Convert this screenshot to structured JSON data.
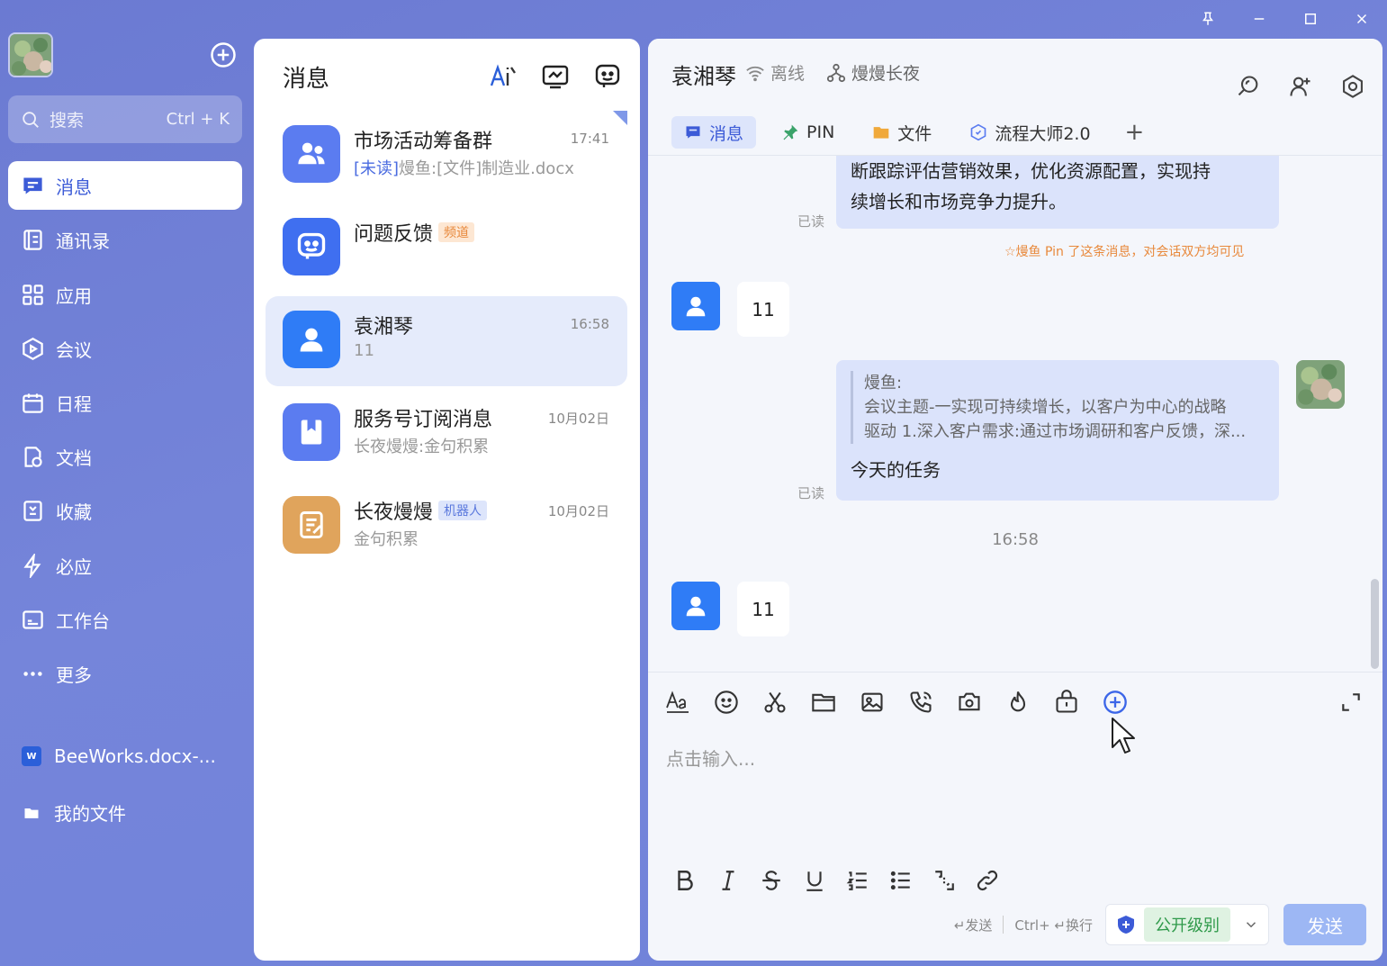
{
  "window": {
    "controls": [
      "pin-icon",
      "minimize-icon",
      "maximize-icon",
      "close-icon"
    ]
  },
  "nav": {
    "search": {
      "placeholder": "搜索",
      "shortcut": "Ctrl + K"
    },
    "items": [
      {
        "label": "消息",
        "icon": "message-icon",
        "active": true
      },
      {
        "label": "通讯录",
        "icon": "contacts-icon"
      },
      {
        "label": "应用",
        "icon": "apps-icon"
      },
      {
        "label": "会议",
        "icon": "meeting-icon"
      },
      {
        "label": "日程",
        "icon": "calendar-icon"
      },
      {
        "label": "文档",
        "icon": "document-icon"
      },
      {
        "label": "收藏",
        "icon": "favorites-icon"
      },
      {
        "label": "必应",
        "icon": "lightning-icon"
      },
      {
        "label": "工作台",
        "icon": "workbench-icon"
      },
      {
        "label": "更多",
        "icon": "more-icon"
      }
    ],
    "files": [
      {
        "label": "BeeWorks.docx-...",
        "icon": "word-file-icon"
      },
      {
        "label": "我的文件",
        "icon": "folder-file-icon"
      }
    ]
  },
  "conversations": {
    "title": "消息",
    "items": [
      {
        "name": "市场活动筹备群",
        "time": "17:41",
        "unread_tag": "[未读]",
        "preview": "熳鱼:[文件]制造业.docx",
        "color": "#5b7cf0",
        "icon": "group-icon"
      },
      {
        "name": "问题反馈",
        "tag": "频道",
        "tag_color": "orange",
        "time": "",
        "preview": "",
        "color": "#3f6ff0",
        "icon": "bot-face-icon"
      },
      {
        "name": "袁湘琴",
        "time": "16:58",
        "preview": "11",
        "color": "#2f7cf6",
        "icon": "person-icon",
        "selected": true
      },
      {
        "name": "服务号订阅消息",
        "time": "10月02日",
        "preview": "长夜熳熳:金句积累",
        "color": "#5b7cf0",
        "icon": "bookmark-icon"
      },
      {
        "name": "长夜熳熳",
        "tag": "机器人",
        "tag_color": "blue",
        "time": "10月02日",
        "preview": "金句积累",
        "color": "#e0a45c",
        "icon": "note-icon"
      }
    ]
  },
  "chat": {
    "contact": "袁湘琴",
    "status": "离线",
    "org": "熳熳长夜",
    "tabs": [
      {
        "label": "消息",
        "icon": "message-icon",
        "active": true
      },
      {
        "label": "PIN",
        "icon": "pin-icon"
      },
      {
        "label": "文件",
        "icon": "folder-icon"
      },
      {
        "label": "流程大师2.0",
        "icon": "flow-icon"
      }
    ],
    "tab_add": "+",
    "messages": {
      "m1_line1": "断跟踪评估营销效果，优化资源配置，实现持",
      "m1_line2": "续增长和市场竞争力提升。",
      "read": "已读",
      "pin_note": "熳鱼 Pin 了这条消息，对会话双方均可见",
      "m2": "11",
      "quote_author": "熳鱼:",
      "quote_line1": "会议主题-一实现可持续增长，以客户为中心的战略",
      "quote_line2": "驱动 1.深入客户需求:通过市场调研和客户反馈，深...",
      "m3": "今天的任务",
      "timestamp": "16:58",
      "m4": "11"
    },
    "composer": {
      "placeholder": "点击输入...",
      "hint_send": "↵发送",
      "hint_newline": "Ctrl+ ↵换行",
      "level": "公开级别",
      "send": "发送"
    }
  }
}
